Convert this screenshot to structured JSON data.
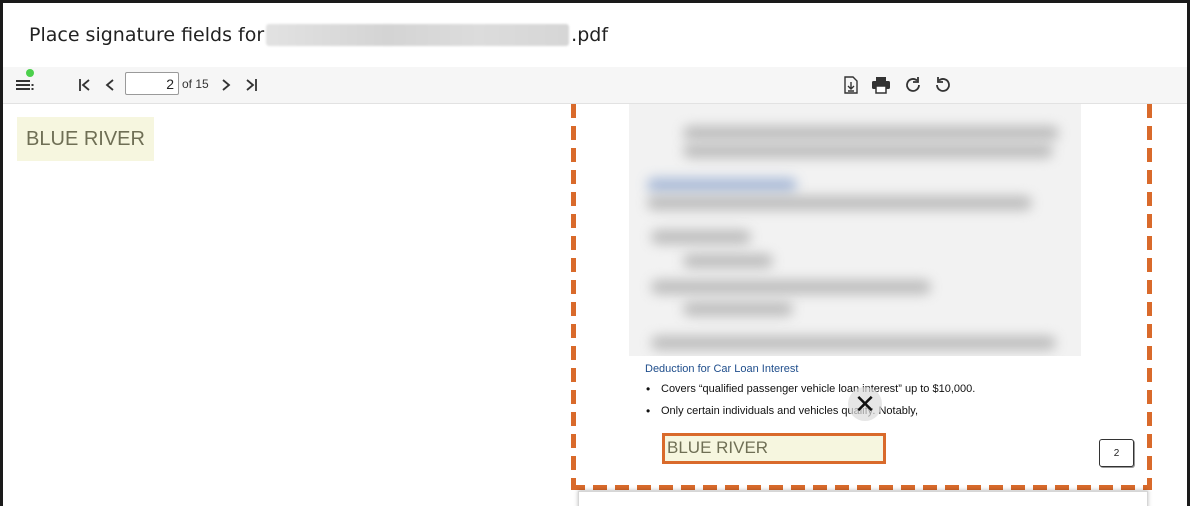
{
  "title": {
    "prefix": "Place signature fields for",
    "suffix": ".pdf"
  },
  "toolbar": {
    "status_color": "#4cd04c",
    "current_page": "2",
    "page_count_label": "of 15"
  },
  "signature_chip": {
    "label": "BLUE RIVER"
  },
  "document": {
    "section_heading": "Deduction for Car Loan Interest",
    "bullets": [
      "Covers “qualified passenger vehicle loan interest” up to $10,000.",
      "Only certain individuals and vehicles qualify. Notably,"
    ],
    "placed_field_label": "BLUE RIVER",
    "page_number": "2",
    "accent_color": "#d96a2b",
    "field_fill": "#f6f6df"
  }
}
